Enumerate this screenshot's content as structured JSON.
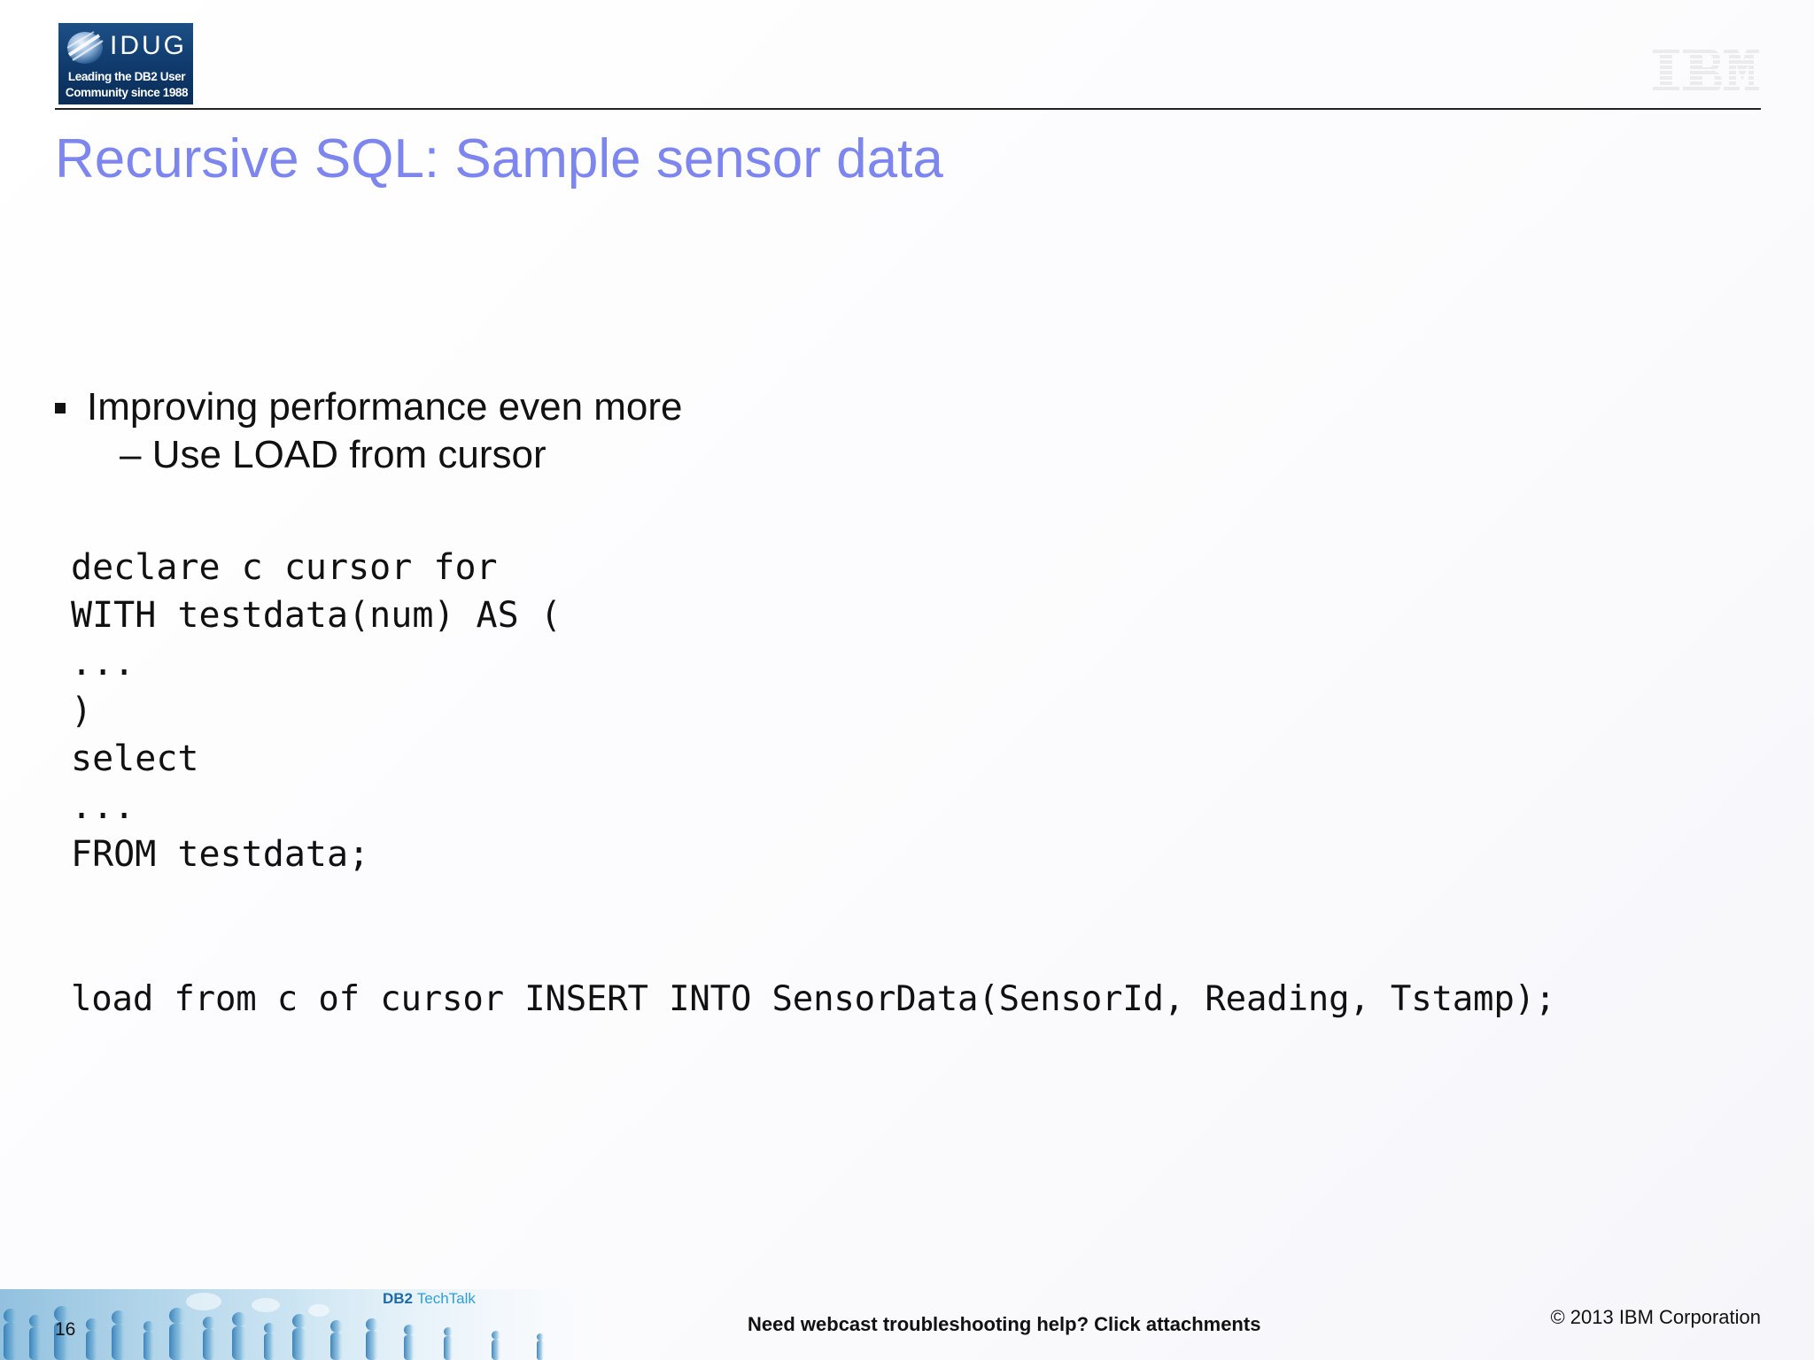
{
  "header": {
    "idug_logo": {
      "wordmark": "IDUG",
      "tagline_line1": "Leading the DB2 User",
      "tagline_line2": "Community since 1988"
    },
    "ibm_logo": "IBM"
  },
  "slide": {
    "title": "Recursive SQL: Sample sensor data",
    "bullets": [
      {
        "text": "Improving performance even more",
        "sub_items": [
          "– Use LOAD from cursor"
        ]
      }
    ],
    "code_lines": [
      "declare c cursor for",
      "WITH testdata(num) AS (",
      "...",
      ")",
      "select",
      "...",
      "FROM testdata;"
    ],
    "load_statement": "load from c of cursor INSERT INTO SensorData(SensorId, Reading, Tstamp);"
  },
  "footer": {
    "page_number": "16",
    "brand_db2": "DB2",
    "brand_techtalk": "TechTalk",
    "help_text": "Need webcast troubleshooting help? Click attachments",
    "copyright": "© 2013 IBM Corporation"
  },
  "colors": {
    "title": "#7d86ee",
    "text": "#111111",
    "idug_blue": "#0f3a6b"
  }
}
